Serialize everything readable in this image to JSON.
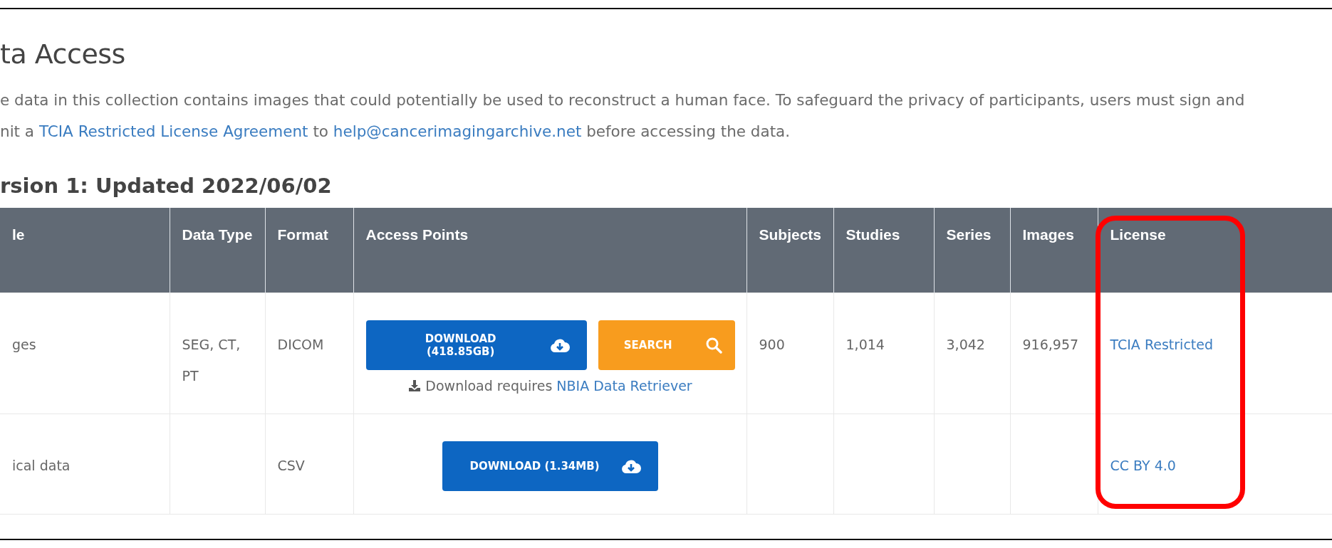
{
  "section_title": "ta Access",
  "notice": {
    "line_1": "e data in this collection contains images that could potentially be used to reconstruct a human face. To safeguard the privacy of participants, users must sign and",
    "line_2": [
      {
        "kind": "text",
        "text": "nit a "
      },
      {
        "kind": "link",
        "text": "TCIA Restricted License Agreement"
      },
      {
        "kind": "text",
        "text": " to "
      },
      {
        "kind": "link",
        "text": "help@cancerimagingarchive.net"
      },
      {
        "kind": "text",
        "text": " before accessing the data."
      }
    ]
  },
  "version_title": "rsion 1: Updated 2022/06/02",
  "table": {
    "columns": [
      "le",
      "Data Type",
      "Format",
      "Access Points",
      "Subjects",
      "Studies",
      "Series",
      "Images",
      "License"
    ],
    "rows": [
      {
        "title": "ges",
        "data_type": "SEG, CT, PT",
        "format": "DICOM",
        "access": {
          "buttons": [
            {
              "kind": "download",
              "label": "DOWNLOAD (418.85GB)"
            },
            {
              "kind": "search",
              "label": "SEARCH"
            }
          ],
          "note": {
            "text": "Download requires ",
            "link": "NBIA Data Retriever"
          }
        },
        "subjects": "900",
        "studies": "1,014",
        "series": "3,042",
        "images": "916,957",
        "license": "TCIA Restricted"
      },
      {
        "title": "ical data",
        "format": "CSV",
        "access": {
          "buttons": [
            {
              "kind": "download",
              "label": "DOWNLOAD (1.34MB)"
            }
          ]
        },
        "license": "CC BY 4.0"
      }
    ]
  }
}
